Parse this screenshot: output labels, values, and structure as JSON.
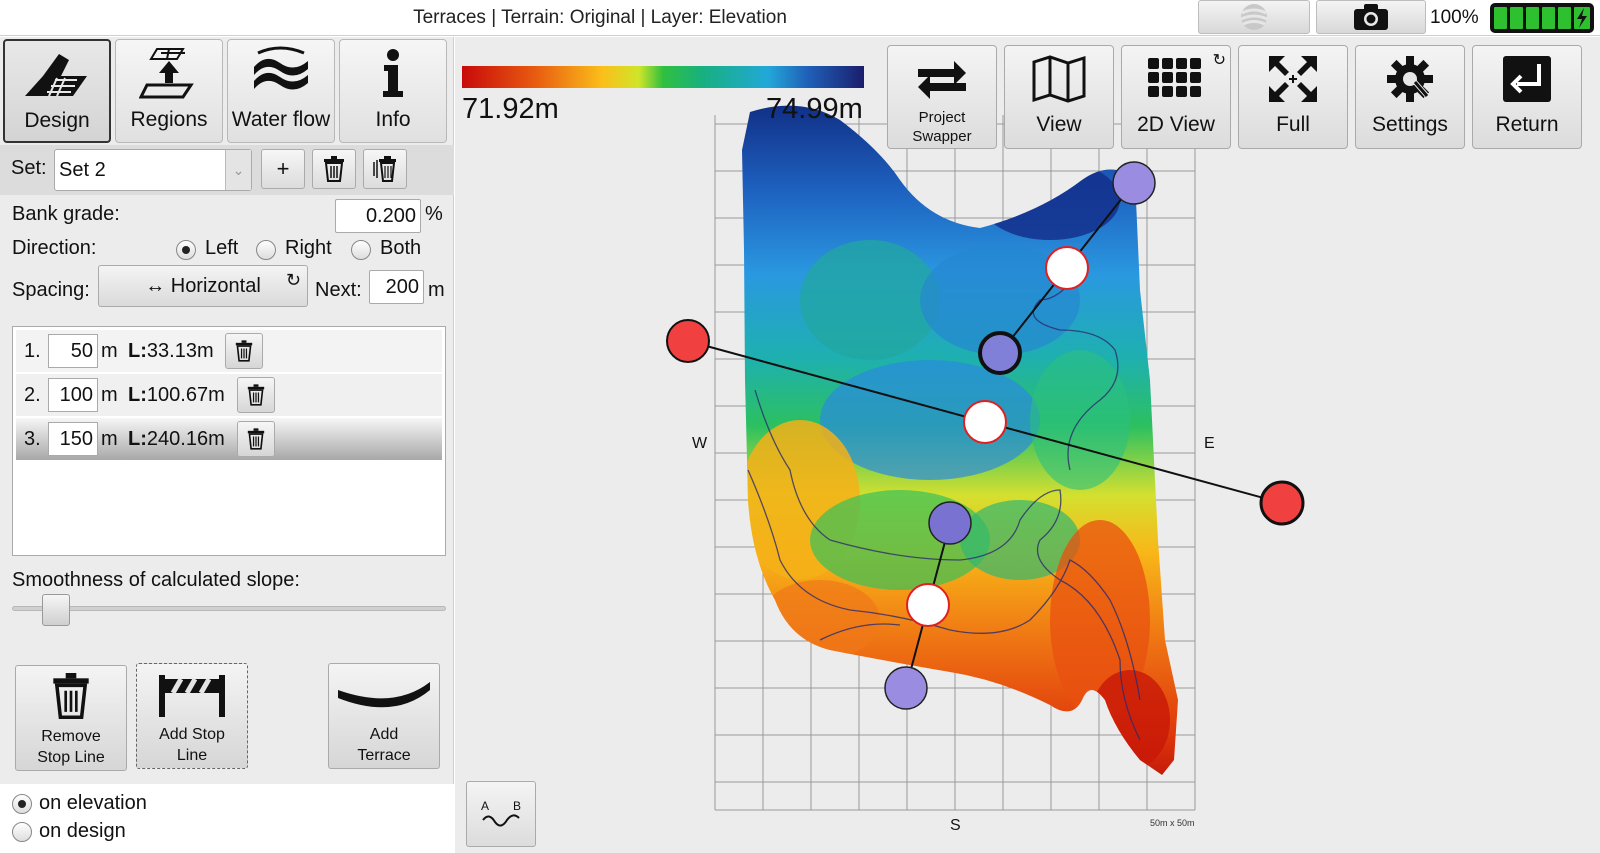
{
  "titlebar": {
    "title": "Terraces | Terrain: Original | Layer: Elevation",
    "battery_percent": "100%",
    "globe_icon": "globe-icon",
    "camera_icon": "camera-icon"
  },
  "mode_tabs": [
    {
      "label": "Design",
      "icon": "design-icon",
      "active": true
    },
    {
      "label": "Regions",
      "icon": "regions-icon",
      "active": false
    },
    {
      "label": "Water flow",
      "icon": "water-flow-icon",
      "active": false
    },
    {
      "label": "Info",
      "icon": "info-icon",
      "active": false
    }
  ],
  "set_row": {
    "label": "Set:",
    "selected": "Set 2",
    "add_label": "+"
  },
  "bank_grade": {
    "label": "Bank grade:",
    "value": "0.200",
    "unit": "%"
  },
  "direction": {
    "label": "Direction:",
    "options": [
      "Left",
      "Right",
      "Both"
    ],
    "selected": "Left"
  },
  "spacing": {
    "label": "Spacing:",
    "button_label": "↔ Horizontal",
    "next_label": "Next:",
    "next_value": "200",
    "unit": "m"
  },
  "lines": [
    {
      "index": "1.",
      "value": "50",
      "unit": "m",
      "length_label": "L:",
      "length": "33.13m",
      "selected": false
    },
    {
      "index": "2.",
      "value": "100",
      "unit": "m",
      "length_label": "L:",
      "length": "100.67m",
      "selected": false
    },
    {
      "index": "3.",
      "value": "150",
      "unit": "m",
      "length_label": "L:",
      "length": "240.16m",
      "selected": true
    }
  ],
  "smoothness": {
    "label": "Smoothness of calculated slope:",
    "level": 0.05
  },
  "actions": {
    "remove_stop_line": "Remove Stop Line",
    "add_stop_line": "Add Stop Line",
    "add_terrace": "Add Terrace"
  },
  "surface_options": {
    "options": [
      "on elevation",
      "on design"
    ],
    "selected": "on elevation"
  },
  "toolbar": {
    "project_swapper": "Project Swapper",
    "view": "View",
    "view_2d": "2D View",
    "full": "Full",
    "settings": "Settings",
    "return": "Return"
  },
  "legend": {
    "min": "71.92m",
    "max": "74.99m"
  },
  "compass": {
    "west": "W",
    "east": "E",
    "south": "S"
  },
  "scale_label": "50m x 50m",
  "ab_profile": {
    "a": "A",
    "b": "B"
  },
  "colors": {
    "handle_red": "#f04040",
    "handle_purple": "#9a8ce0",
    "handle_mid": "#ffffff",
    "battery_green": "#2ec02e"
  }
}
